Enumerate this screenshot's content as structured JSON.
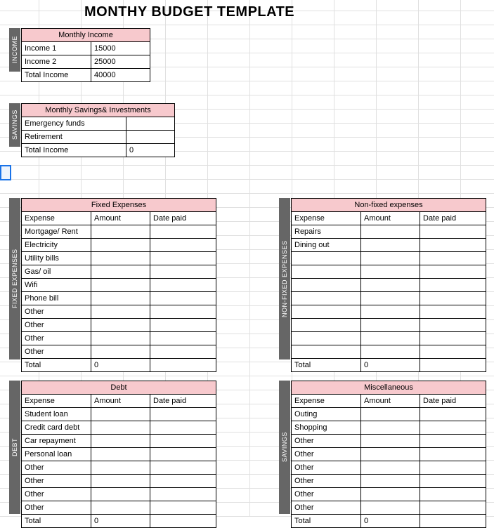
{
  "title": "MONTHY BUDGET TEMPLATE",
  "labels": {
    "income": "INCOME",
    "savings": "SAVINGS",
    "fixed": "FIXED EXPENSES",
    "nonfixed": "NON-FIXED EXPENSES",
    "debt": "DEBT",
    "misc_side": "SAVINGS"
  },
  "income": {
    "header": "Monthly Income",
    "rows": [
      {
        "label": "Income 1",
        "value": "15000"
      },
      {
        "label": "Income 2",
        "value": "25000"
      }
    ],
    "total": {
      "label": "Total Income",
      "value": "40000"
    }
  },
  "savings": {
    "header": "Monthly Savings& Investments",
    "rows": [
      {
        "label": "Emergency funds",
        "value": ""
      },
      {
        "label": "Retirement",
        "value": ""
      }
    ],
    "total": {
      "label": "Total Income",
      "value": "0"
    }
  },
  "columns": {
    "expense": "Expense",
    "amount": "Amount",
    "date": "Date paid",
    "total": "Total"
  },
  "fixed": {
    "header": "Fixed Expenses",
    "rows": [
      "Mortgage/ Rent",
      "Electricity",
      "Utility bills",
      "Gas/ oil",
      "Wifi",
      "Phone bill",
      "Other",
      "Other",
      "Other",
      "Other"
    ],
    "total": "0"
  },
  "nonfixed": {
    "header": "Non-fixed expenses",
    "rows": [
      "Repairs",
      "Dining out",
      "",
      "",
      "",
      "",
      "",
      "",
      "",
      ""
    ],
    "total": "0"
  },
  "debt": {
    "header": "Debt",
    "rows": [
      "Student loan",
      "Credit card debt",
      "Car repayment",
      "Personal loan",
      "Other",
      "Other",
      "Other",
      "Other"
    ],
    "total": "0"
  },
  "misc": {
    "header": "Miscellaneous",
    "rows": [
      "Outing",
      "Shopping",
      "Other",
      "Other",
      "Other",
      "Other",
      "Other",
      "Other"
    ],
    "total": "0"
  }
}
